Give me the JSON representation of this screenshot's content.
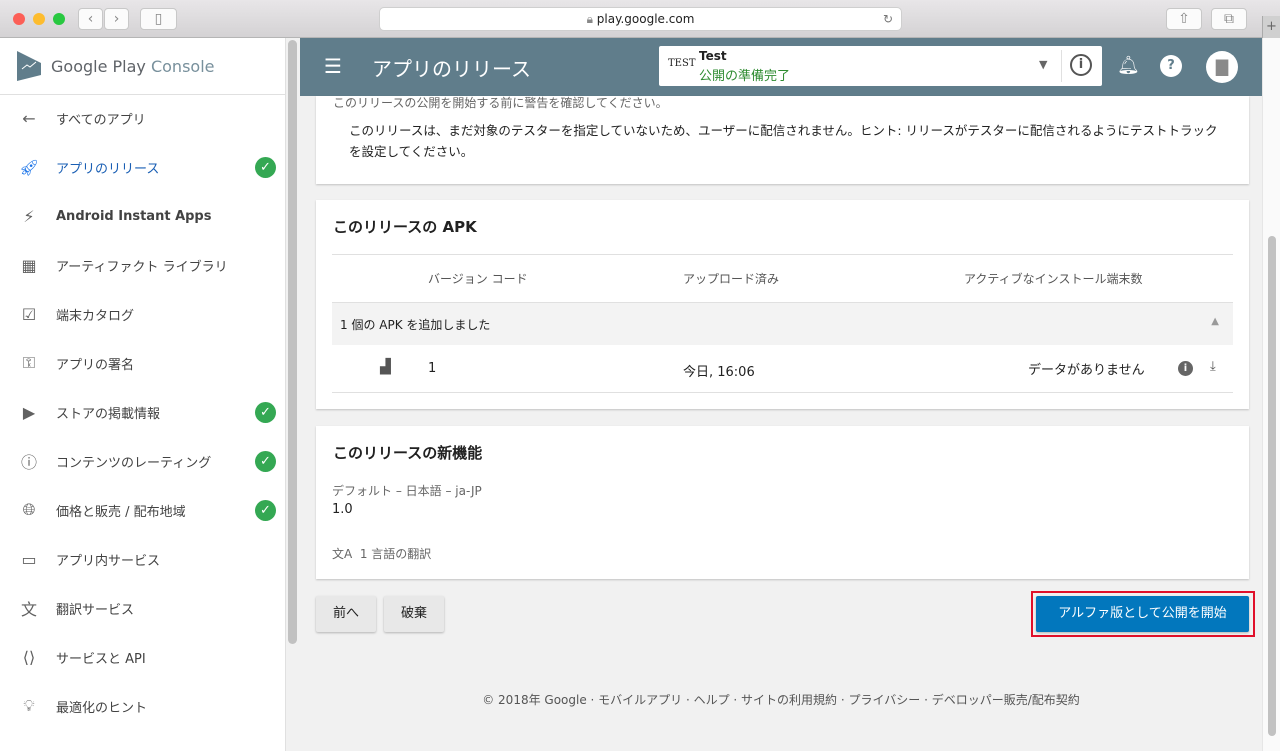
{
  "browser": {
    "url": "play.google.com"
  },
  "sidebar": {
    "logo_main": "Google Play",
    "logo_sub": "Console",
    "items": [
      {
        "label": "すべてのアプリ",
        "icon": "arrow-left-icon",
        "check": false
      },
      {
        "label": "アプリのリリース",
        "icon": "rocket-icon",
        "check": true,
        "active": true
      },
      {
        "label": "Android Instant Apps",
        "icon": "bolt-icon",
        "check": false
      },
      {
        "label": "アーティファクト ライブラリ",
        "icon": "grid-icon",
        "check": false
      },
      {
        "label": "端末カタログ",
        "icon": "device-check-icon",
        "check": false
      },
      {
        "label": "アプリの署名",
        "icon": "key-icon",
        "check": false
      },
      {
        "label": "ストアの掲載情報",
        "icon": "store-play-icon",
        "check": true
      },
      {
        "label": "コンテンツのレーティング",
        "icon": "rating-icon",
        "check": true
      },
      {
        "label": "価格と販売 / 配布地域",
        "icon": "globe-icon",
        "check": true
      },
      {
        "label": "アプリ内サービス",
        "icon": "card-icon",
        "check": false
      },
      {
        "label": "翻訳サービス",
        "icon": "translate-icon",
        "check": false
      },
      {
        "label": "サービスと API",
        "icon": "api-icon",
        "check": false
      },
      {
        "label": "最適化のヒント",
        "icon": "lightbulb-icon",
        "check": false
      }
    ]
  },
  "header": {
    "title": "アプリのリリース",
    "app_name": "Test",
    "app_status": "公開の準備完了",
    "app_icon_text": "TEST"
  },
  "warning": {
    "intro": "このリリースの公開を開始する前に警告を確認してください。",
    "text": "このリリースは、まだ対象のテスターを指定していないため、ユーザーに配信されません。ヒント: リリースがテスターに配信されるようにテストトラックを設定してください。"
  },
  "apk": {
    "title": "このリリースの APK",
    "columns": [
      "バージョン コード",
      "アップロード済み",
      "アクティブなインストール端末数"
    ],
    "group_label": "1 個の APK を追加しました",
    "row": {
      "version": "1",
      "uploaded": "今日, 16:06",
      "installs": "データがありません"
    }
  },
  "whatsnew": {
    "title": "このリリースの新機能",
    "lang": "デフォルト – 日本語 – ja-JP",
    "text": "1.0",
    "translations": "1 言語の翻訳"
  },
  "actions": {
    "back": "前へ",
    "discard": "破棄",
    "publish": "アルファ版として公開を開始"
  },
  "footer": "© 2018年 Google · モバイルアプリ · ヘルプ · サイトの利用規約 · プライバシー · デベロッパー販売/配布契約",
  "colors": {
    "header": "#607d8b",
    "primary": "#0277bd",
    "success": "#34a853",
    "highlight": "#e0102a"
  }
}
